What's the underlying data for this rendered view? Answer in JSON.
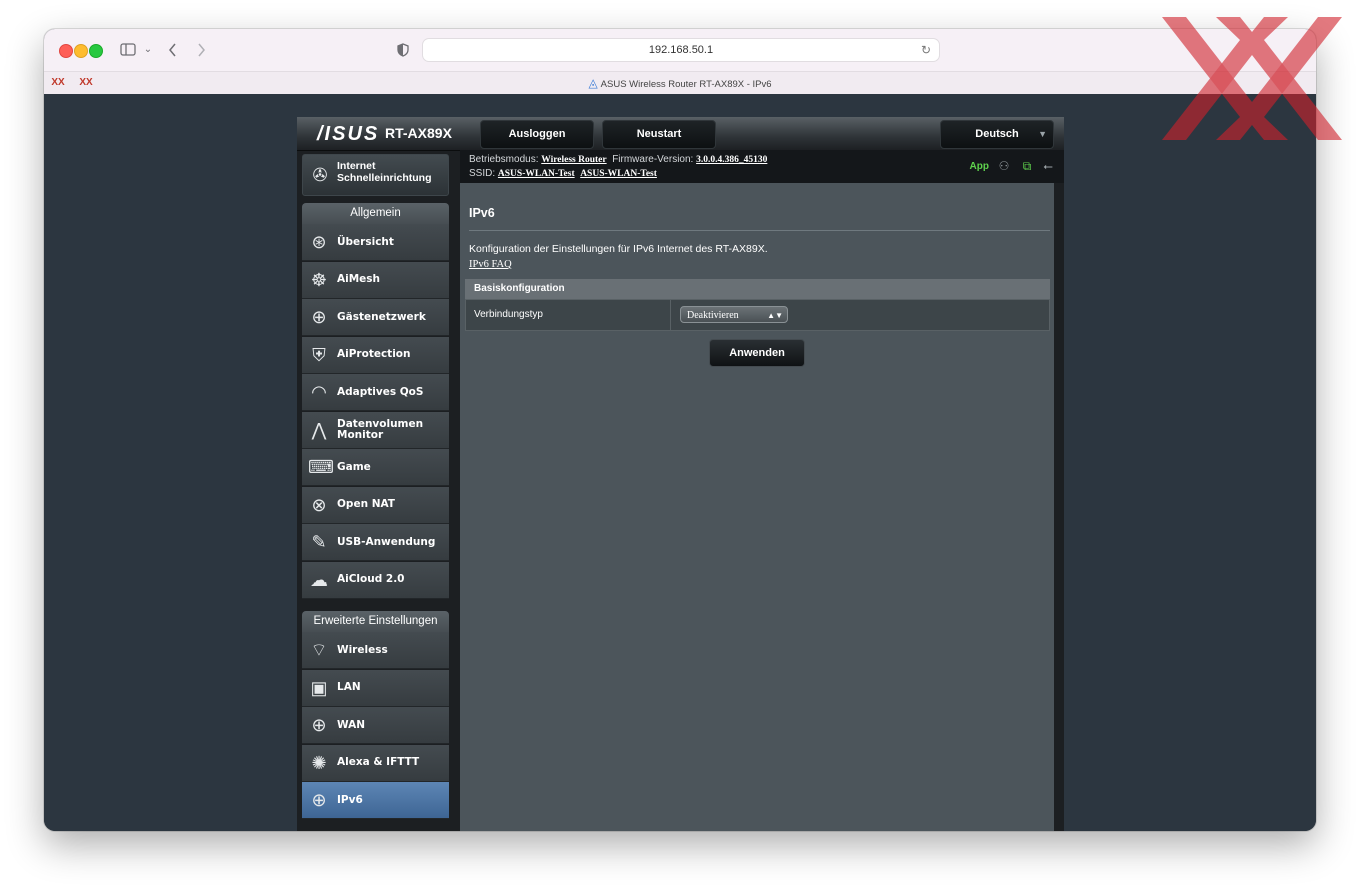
{
  "browser": {
    "url": "192.168.50.1",
    "tab_title": "ASUS Wireless Router RT-AX89X - IPv6",
    "favicons": [
      "XX",
      "XX"
    ]
  },
  "header": {
    "brand": "/ISUS",
    "model": "RT-AX89X",
    "logout": "Ausloggen",
    "reboot": "Neustart",
    "language": "Deutsch"
  },
  "status": {
    "mode_label": "Betriebsmodus:",
    "mode_value": "Wireless Router",
    "firmware_label": "Firmware-Version:",
    "firmware_value": "3.0.0.4.386_45130",
    "ssid_label": "SSID:",
    "ssid_1": "ASUS-WLAN-Test",
    "ssid_2": "ASUS-WLAN-Test",
    "app": "App"
  },
  "sidebar": {
    "qis_line1": "Internet",
    "qis_line2": "Schnelleinrichtung",
    "general_title": "Allgemein",
    "general_items": [
      {
        "label": "Übersicht",
        "icon": "network-map-icon"
      },
      {
        "label": "AiMesh",
        "icon": "aimesh-icon"
      },
      {
        "label": "Gästenetzwerk",
        "icon": "guest-network-icon"
      },
      {
        "label": "AiProtection",
        "icon": "shield-lock-icon"
      },
      {
        "label": "Adaptives QoS",
        "icon": "speedometer-icon"
      },
      {
        "label": "Datenvolumen Monitor",
        "icon": "traffic-monitor-icon"
      },
      {
        "label": "Game",
        "icon": "gamepad-icon"
      },
      {
        "label": "Open NAT",
        "icon": "open-nat-icon"
      },
      {
        "label": "USB-Anwendung",
        "icon": "usb-icon"
      },
      {
        "label": "AiCloud 2.0",
        "icon": "cloud-icon"
      }
    ],
    "advanced_title": "Erweiterte Einstellungen",
    "advanced_items": [
      {
        "label": "Wireless",
        "icon": "wifi-icon"
      },
      {
        "label": "LAN",
        "icon": "lan-icon"
      },
      {
        "label": "WAN",
        "icon": "globe-icon"
      },
      {
        "label": "Alexa & IFTTT",
        "icon": "alexa-icon"
      },
      {
        "label": "IPv6",
        "icon": "ipv6-globe-icon"
      }
    ]
  },
  "main": {
    "title": "IPv6",
    "description": "Konfiguration der Einstellungen für IPv6 Internet des RT-AX89X.",
    "faq_link": "IPv6 FAQ",
    "table_header": "Basiskonfiguration",
    "connection_label": "Verbindungstyp",
    "connection_value": "Deaktivieren",
    "apply": "Anwenden"
  },
  "colors": {
    "accent_active": "#4f78a8",
    "app_green": "#5fd34d",
    "watermark_red": "#d0202a"
  }
}
